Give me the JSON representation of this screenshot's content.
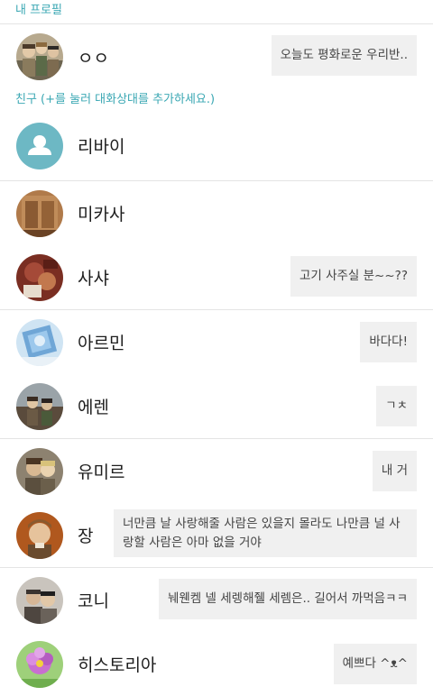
{
  "headers": {
    "my_profile": "내 프로필",
    "friends": "친구 (+를 눌러 대화상대를 추가하세요.)"
  },
  "me": {
    "name": "ㅇㅇ",
    "status": "오늘도 평화로운 우리반.."
  },
  "friends": [
    {
      "name": "리바이",
      "status": "",
      "avatar": "default-person-icon"
    },
    {
      "name": "미카사",
      "status": ""
    },
    {
      "name": "사샤",
      "status": "고기 사주실 분~~??"
    },
    {
      "name": "아르민",
      "status": "바다다!"
    },
    {
      "name": "에렌",
      "status": "ㄱㅊ"
    },
    {
      "name": "유미르",
      "status": "내 거"
    },
    {
      "name": "장",
      "status": "너만큼 날 사랑해줄 사람은 있을지 몰라도 나만큼 널 사랑할 사람은 아마 없을 거야"
    },
    {
      "name": "코니",
      "status": "눼웬켐 넬 세렝해줼 세렘은.. 길어서 까먹음ㅋㅋ"
    },
    {
      "name": "히스토리아",
      "status": "예쁘다 ^ᴥ^"
    }
  ],
  "colors": {
    "accent": "#3aa7b3",
    "bubble_bg": "#f0f0f0",
    "default_avatar": "#6db8c4"
  }
}
